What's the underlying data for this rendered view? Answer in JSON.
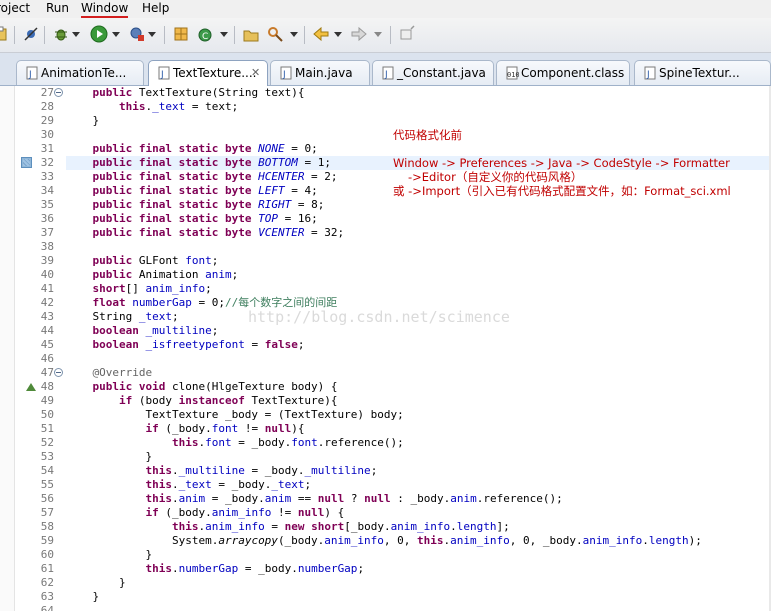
{
  "menu": [
    "roject",
    "Run",
    "Window",
    "Help"
  ],
  "tabs": [
    {
      "label": "AnimationTe...",
      "icon": "java-file-icon"
    },
    {
      "label": "TextTexture....",
      "icon": "java-file-icon",
      "active": true,
      "close": "✕"
    },
    {
      "label": "Main.java",
      "icon": "java-file-icon"
    },
    {
      "label": "_Constant.java",
      "icon": "java-file-icon"
    },
    {
      "label": "Component.class",
      "icon": "class-file-icon"
    },
    {
      "label": "SpineTextur...",
      "icon": "java-file-icon"
    }
  ],
  "annotations": {
    "title": "代码格式化前",
    "path": "Window -> Preferences -> Java -> CodeStyle -> Formatter",
    "editor": "->Editor（自定义你的代码风格）",
    "import": "或 ->Import（引入已有代码格式配置文件，如：Format_sci.xml"
  },
  "watermark": "http://blog.csdn.net/scimence",
  "lines": [
    {
      "n": "27",
      "fold": true,
      "tokens": [
        [
          "    ",
          ""
        ],
        [
          "public",
          "kw"
        ],
        [
          " TextTexture(String text){",
          ""
        ]
      ]
    },
    {
      "n": "28",
      "tokens": [
        [
          "        ",
          ""
        ],
        [
          "this",
          "kw"
        ],
        [
          ".",
          ""
        ],
        [
          "_text",
          "fld"
        ],
        [
          " = text;",
          ""
        ]
      ]
    },
    {
      "n": "29",
      "tokens": [
        [
          "    }",
          ""
        ]
      ]
    },
    {
      "n": "30",
      "tokens": []
    },
    {
      "n": "31",
      "tokens": [
        [
          "    ",
          ""
        ],
        [
          "public final static byte",
          "kw"
        ],
        [
          " ",
          ""
        ],
        [
          "NONE",
          "sfld"
        ],
        [
          " = 0;",
          ""
        ]
      ]
    },
    {
      "n": "32",
      "highlight": true,
      "mark": true,
      "tokens": [
        [
          "    ",
          ""
        ],
        [
          "public final static byte",
          "kw"
        ],
        [
          " ",
          ""
        ],
        [
          "BOTTOM",
          "sfld"
        ],
        [
          " = 1;",
          ""
        ]
      ]
    },
    {
      "n": "33",
      "tokens": [
        [
          "    ",
          ""
        ],
        [
          "public final static byte",
          "kw"
        ],
        [
          " ",
          ""
        ],
        [
          "HCENTER",
          "sfld"
        ],
        [
          " = 2;",
          ""
        ]
      ]
    },
    {
      "n": "34",
      "tokens": [
        [
          "    ",
          ""
        ],
        [
          "public final static byte",
          "kw"
        ],
        [
          " ",
          ""
        ],
        [
          "LEFT",
          "sfld"
        ],
        [
          " = 4;",
          ""
        ]
      ]
    },
    {
      "n": "35",
      "tokens": [
        [
          "    ",
          ""
        ],
        [
          "public final static byte",
          "kw"
        ],
        [
          " ",
          ""
        ],
        [
          "RIGHT",
          "sfld"
        ],
        [
          " = 8;",
          ""
        ]
      ]
    },
    {
      "n": "36",
      "tokens": [
        [
          "    ",
          ""
        ],
        [
          "public final static byte",
          "kw"
        ],
        [
          " ",
          ""
        ],
        [
          "TOP",
          "sfld"
        ],
        [
          " = 16;",
          ""
        ]
      ]
    },
    {
      "n": "37",
      "tokens": [
        [
          "    ",
          ""
        ],
        [
          "public final static byte",
          "kw"
        ],
        [
          " ",
          ""
        ],
        [
          "VCENTER",
          "sfld"
        ],
        [
          " = 32;",
          ""
        ]
      ]
    },
    {
      "n": "38",
      "tokens": []
    },
    {
      "n": "39",
      "tokens": [
        [
          "    ",
          ""
        ],
        [
          "public",
          "kw"
        ],
        [
          " GLFont ",
          ""
        ],
        [
          "font",
          "fld"
        ],
        [
          ";",
          ""
        ]
      ]
    },
    {
      "n": "40",
      "tokens": [
        [
          "    ",
          ""
        ],
        [
          "public",
          "kw"
        ],
        [
          " Animation ",
          ""
        ],
        [
          "anim",
          "fld"
        ],
        [
          ";",
          ""
        ]
      ]
    },
    {
      "n": "41",
      "tokens": [
        [
          "    ",
          ""
        ],
        [
          "short",
          "kw"
        ],
        [
          "[] ",
          ""
        ],
        [
          "anim_info",
          "fld"
        ],
        [
          ";",
          ""
        ]
      ]
    },
    {
      "n": "42",
      "tokens": [
        [
          "    ",
          ""
        ],
        [
          "float",
          "kw"
        ],
        [
          " ",
          ""
        ],
        [
          "numberGap",
          "fld"
        ],
        [
          " = 0;",
          ""
        ],
        [
          "//每个数字之间的间距",
          "cmt"
        ]
      ]
    },
    {
      "n": "43",
      "tokens": [
        [
          "    String ",
          ""
        ],
        [
          "_text",
          "fld"
        ],
        [
          ";",
          ""
        ]
      ]
    },
    {
      "n": "44",
      "tokens": [
        [
          "    ",
          ""
        ],
        [
          "boolean",
          "kw"
        ],
        [
          " ",
          ""
        ],
        [
          "_multiline",
          "fld"
        ],
        [
          ";",
          ""
        ]
      ]
    },
    {
      "n": "45",
      "tokens": [
        [
          "    ",
          ""
        ],
        [
          "boolean",
          "kw"
        ],
        [
          " ",
          ""
        ],
        [
          "_isfreetypefont",
          "fld"
        ],
        [
          " = ",
          ""
        ],
        [
          "false",
          "kw"
        ],
        [
          ";",
          ""
        ]
      ]
    },
    {
      "n": "46",
      "tokens": []
    },
    {
      "n": "47",
      "fold": true,
      "tokens": [
        [
          "    ",
          ""
        ],
        [
          "@Override",
          "ann"
        ]
      ]
    },
    {
      "n": "48",
      "override": true,
      "tokens": [
        [
          "    ",
          ""
        ],
        [
          "public void",
          "kw"
        ],
        [
          " clone(HlgeTexture body) {",
          ""
        ]
      ]
    },
    {
      "n": "49",
      "tokens": [
        [
          "        ",
          ""
        ],
        [
          "if",
          "kw"
        ],
        [
          " (body ",
          ""
        ],
        [
          "instanceof",
          "kw"
        ],
        [
          " TextTexture){",
          ""
        ]
      ]
    },
    {
      "n": "50",
      "tokens": [
        [
          "            TextTexture _body = (TextTexture) body;",
          ""
        ]
      ]
    },
    {
      "n": "51",
      "tokens": [
        [
          "            ",
          ""
        ],
        [
          "if",
          "kw"
        ],
        [
          " (_body.",
          ""
        ],
        [
          "font",
          "fld"
        ],
        [
          " != ",
          ""
        ],
        [
          "null",
          "kw"
        ],
        [
          "){",
          ""
        ]
      ]
    },
    {
      "n": "52",
      "tokens": [
        [
          "                ",
          ""
        ],
        [
          "this",
          "kw"
        ],
        [
          ".",
          ""
        ],
        [
          "font",
          "fld"
        ],
        [
          " = _body.",
          ""
        ],
        [
          "font",
          "fld"
        ],
        [
          ".reference();",
          ""
        ]
      ]
    },
    {
      "n": "53",
      "tokens": [
        [
          "            }",
          ""
        ]
      ]
    },
    {
      "n": "54",
      "tokens": [
        [
          "            ",
          ""
        ],
        [
          "this",
          "kw"
        ],
        [
          ".",
          ""
        ],
        [
          "_multiline",
          "fld"
        ],
        [
          " = _body.",
          ""
        ],
        [
          "_multiline",
          "fld"
        ],
        [
          ";",
          ""
        ]
      ]
    },
    {
      "n": "55",
      "tokens": [
        [
          "            ",
          ""
        ],
        [
          "this",
          "kw"
        ],
        [
          ".",
          ""
        ],
        [
          "_text",
          "fld"
        ],
        [
          " = _body.",
          ""
        ],
        [
          "_text",
          "fld"
        ],
        [
          ";",
          ""
        ]
      ]
    },
    {
      "n": "56",
      "tokens": [
        [
          "            ",
          ""
        ],
        [
          "this",
          "kw"
        ],
        [
          ".",
          ""
        ],
        [
          "anim",
          "fld"
        ],
        [
          " = _body.",
          ""
        ],
        [
          "anim",
          "fld"
        ],
        [
          " == ",
          ""
        ],
        [
          "null",
          "kw"
        ],
        [
          " ? ",
          ""
        ],
        [
          "null",
          "kw"
        ],
        [
          " : _body.",
          ""
        ],
        [
          "anim",
          "fld"
        ],
        [
          ".reference();",
          ""
        ]
      ]
    },
    {
      "n": "57",
      "tokens": [
        [
          "            ",
          ""
        ],
        [
          "if",
          "kw"
        ],
        [
          " (_body.",
          ""
        ],
        [
          "anim_info",
          "fld"
        ],
        [
          " != ",
          ""
        ],
        [
          "null",
          "kw"
        ],
        [
          ") {",
          ""
        ]
      ]
    },
    {
      "n": "58",
      "tokens": [
        [
          "                ",
          ""
        ],
        [
          "this",
          "kw"
        ],
        [
          ".",
          ""
        ],
        [
          "anim_info",
          "fld"
        ],
        [
          " = ",
          ""
        ],
        [
          "new",
          "kw"
        ],
        [
          " ",
          ""
        ],
        [
          "short",
          "kw"
        ],
        [
          "[_body.",
          ""
        ],
        [
          "anim_info",
          "fld"
        ],
        [
          ".",
          ""
        ],
        [
          "length",
          "fld"
        ],
        [
          "];",
          ""
        ]
      ]
    },
    {
      "n": "59",
      "tokens": [
        [
          "                System.",
          ""
        ],
        [
          "arraycopy",
          "smeth"
        ],
        [
          "(_body.",
          ""
        ],
        [
          "anim_info",
          "fld"
        ],
        [
          ", 0, ",
          ""
        ],
        [
          "this",
          "kw"
        ],
        [
          ".",
          ""
        ],
        [
          "anim_info",
          "fld"
        ],
        [
          ", 0, _body.",
          ""
        ],
        [
          "anim_info",
          "fld"
        ],
        [
          ".",
          ""
        ],
        [
          "length",
          "fld"
        ],
        [
          ");",
          ""
        ]
      ]
    },
    {
      "n": "60",
      "tokens": [
        [
          "            }",
          ""
        ]
      ]
    },
    {
      "n": "61",
      "tokens": [
        [
          "            ",
          ""
        ],
        [
          "this",
          "kw"
        ],
        [
          ".",
          ""
        ],
        [
          "numberGap",
          "fld"
        ],
        [
          " = _body.",
          ""
        ],
        [
          "numberGap",
          "fld"
        ],
        [
          ";",
          ""
        ]
      ]
    },
    {
      "n": "62",
      "tokens": [
        [
          "        }",
          ""
        ]
      ]
    },
    {
      "n": "63",
      "tokens": [
        [
          "    }",
          ""
        ]
      ]
    },
    {
      "n": "64",
      "tokens": []
    }
  ]
}
